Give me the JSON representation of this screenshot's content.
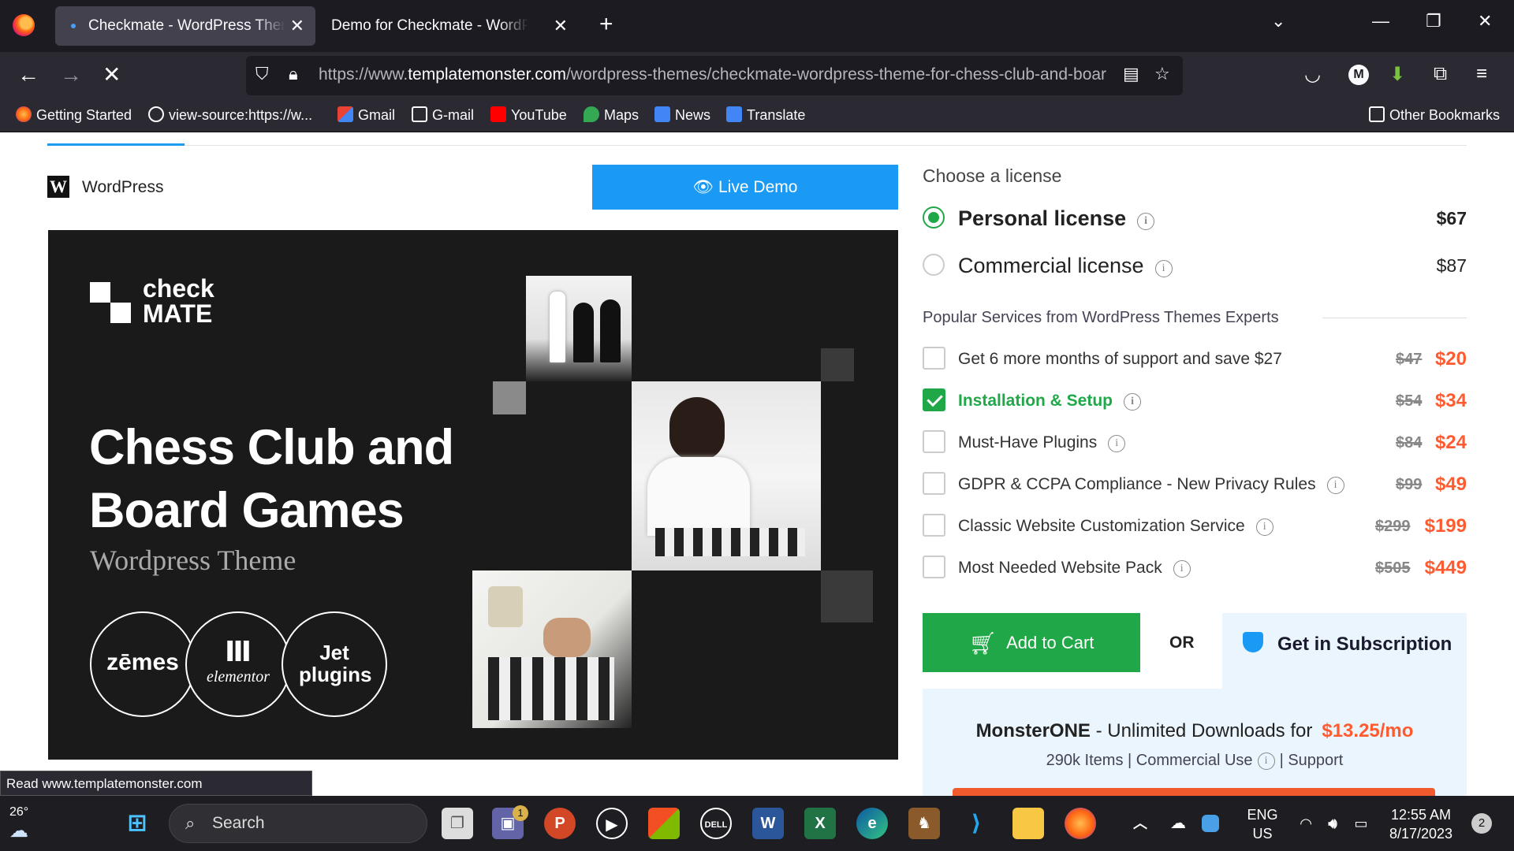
{
  "browser": {
    "tabs": [
      {
        "title": "Checkmate - WordPress Theme",
        "active": true
      },
      {
        "title": "Demo for Checkmate - WordPress T",
        "active": false
      }
    ],
    "url_prefix": "https://www.",
    "url_domain": "templatemonster.com",
    "url_path": "/wordpress-themes/checkmate-wordpress-theme-for-chess-club-and-boar",
    "bookmarks": [
      "Getting Started",
      "view-source:https://w...",
      "Gmail",
      "G-mail",
      "YouTube",
      "Maps",
      "News",
      "Translate"
    ],
    "other_bookmarks": "Other Bookmarks",
    "avatar_letter": "M",
    "status_text": "Read www.templatemonster.com"
  },
  "product": {
    "platform_label": "WordPress",
    "platform_logo_letter": "W",
    "live_demo_label": "Live Demo",
    "banner": {
      "logo_line1": "check",
      "logo_line2": "MATE",
      "title_line1": "Chess Club and",
      "title_line2": "Board Games",
      "subtitle": "Wordpress Theme",
      "badges": [
        "zēmes",
        "elementor",
        "Jet plugins"
      ]
    }
  },
  "license": {
    "heading": "Choose a license",
    "options": [
      {
        "name": "Personal license",
        "price": "$67",
        "selected": true
      },
      {
        "name": "Commercial license",
        "price": "$87",
        "selected": false
      }
    ]
  },
  "services": {
    "heading": "Popular Services from WordPress Themes Experts",
    "items": [
      {
        "name": "Get 6 more months of support and save $27",
        "old_price": "$47",
        "new_price": "$20",
        "checked": false,
        "info": false
      },
      {
        "name": "Installation & Setup",
        "old_price": "$54",
        "new_price": "$34",
        "checked": true,
        "info": true
      },
      {
        "name": "Must-Have Plugins",
        "old_price": "$84",
        "new_price": "$24",
        "checked": false,
        "info": true
      },
      {
        "name": "GDPR & CCPA Compliance - New Privacy Rules",
        "old_price": "$99",
        "new_price": "$49",
        "checked": false,
        "info": true
      },
      {
        "name": "Classic Website Customization Service",
        "old_price": "$299",
        "new_price": "$199",
        "checked": false,
        "info": true
      },
      {
        "name": "Most Needed Website Pack",
        "old_price": "$505",
        "new_price": "$449",
        "checked": false,
        "info": true
      }
    ]
  },
  "purchase": {
    "add_to_cart": "Add to Cart",
    "or": "OR",
    "subscription": "Get in Subscription",
    "monsterone_name": "MonsterONE",
    "monsterone_text": " - Unlimited Downloads for",
    "monsterone_price": "$13.25/mo",
    "monsterone_details": "290k Items | Commercial Use",
    "monsterone_support": "| Support"
  },
  "taskbar": {
    "weather_temp": "26°",
    "search_placeholder": "Search",
    "teams_badge": "1",
    "lang_line1": "ENG",
    "lang_line2": "US",
    "time": "12:55 AM",
    "date": "8/17/2023",
    "notifications": "2"
  },
  "colors": {
    "accent_blue": "#1a9af5",
    "accent_green": "#20a848",
    "price_orange": "#ff5b30"
  }
}
